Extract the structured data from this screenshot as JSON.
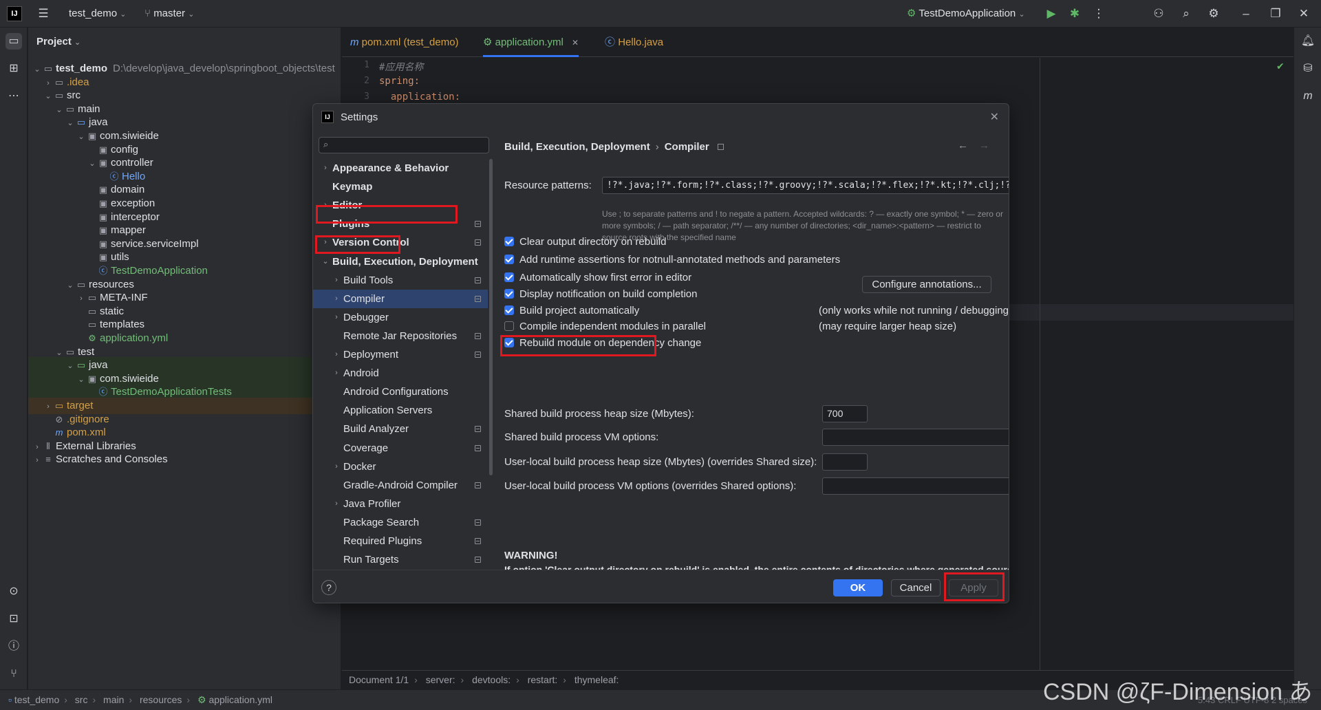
{
  "titlebar": {
    "project": "test_demo",
    "branch": "master",
    "run_config": "TestDemoApplication",
    "logo": "IJ"
  },
  "project_panel": {
    "header": "Project",
    "tree": [
      {
        "name": "test_demo",
        "extra": "D:\\develop\\java_develop\\springboot_objects\\test",
        "depth": 0,
        "arrow": "v",
        "icon": "folder",
        "style": "bold"
      },
      {
        "name": ".idea",
        "depth": 1,
        "arrow": ">",
        "icon": "folder",
        "style": "orange"
      },
      {
        "name": "src",
        "depth": 1,
        "arrow": "v",
        "icon": "folder"
      },
      {
        "name": "main",
        "depth": 2,
        "arrow": "v",
        "icon": "folder"
      },
      {
        "name": "java",
        "depth": 3,
        "arrow": "v",
        "icon": "folder-blue"
      },
      {
        "name": "com.siwieide",
        "depth": 4,
        "arrow": "v",
        "icon": "package"
      },
      {
        "name": "config",
        "depth": 5,
        "icon": "package"
      },
      {
        "name": "controller",
        "depth": 5,
        "arrow": "v",
        "icon": "package"
      },
      {
        "name": "Hello",
        "depth": 6,
        "icon": "class",
        "style": "blue"
      },
      {
        "name": "domain",
        "depth": 5,
        "icon": "package"
      },
      {
        "name": "exception",
        "depth": 5,
        "icon": "package"
      },
      {
        "name": "interceptor",
        "depth": 5,
        "icon": "package"
      },
      {
        "name": "mapper",
        "depth": 5,
        "icon": "package"
      },
      {
        "name": "service.serviceImpl",
        "depth": 5,
        "icon": "package"
      },
      {
        "name": "utils",
        "depth": 5,
        "icon": "package"
      },
      {
        "name": "TestDemoApplication",
        "depth": 5,
        "icon": "spring",
        "style": "green"
      },
      {
        "name": "resources",
        "depth": 3,
        "arrow": "v",
        "icon": "folder"
      },
      {
        "name": "META-INF",
        "depth": 4,
        "arrow": ">",
        "icon": "folder"
      },
      {
        "name": "static",
        "depth": 4,
        "icon": "folder"
      },
      {
        "name": "templates",
        "depth": 4,
        "icon": "folder"
      },
      {
        "name": "application.yml",
        "depth": 4,
        "icon": "yml",
        "style": "green"
      },
      {
        "name": "test",
        "depth": 2,
        "arrow": "v",
        "icon": "folder"
      },
      {
        "name": "java",
        "depth": 3,
        "arrow": "v",
        "icon": "folder-green",
        "bg": "test"
      },
      {
        "name": "com.siwieide",
        "depth": 4,
        "arrow": "v",
        "icon": "package",
        "bg": "test"
      },
      {
        "name": "TestDemoApplicationTests",
        "depth": 5,
        "icon": "spring",
        "style": "green",
        "bg": "test"
      },
      {
        "name": "target",
        "depth": 1,
        "arrow": ">",
        "icon": "folder-orange",
        "style": "orange",
        "bg": "target"
      },
      {
        "name": ".gitignore",
        "depth": 1,
        "icon": "ignore",
        "style": "orange"
      },
      {
        "name": "pom.xml",
        "depth": 1,
        "icon": "maven",
        "style": "orange"
      },
      {
        "name": "External Libraries",
        "depth": 0,
        "arrow": ">",
        "icon": "library"
      },
      {
        "name": "Scratches and Consoles",
        "depth": 0,
        "arrow": ">",
        "icon": "scratch"
      }
    ]
  },
  "editor": {
    "tabs": [
      {
        "label": "pom.xml (test_demo)",
        "icon": "m",
        "style": "orange"
      },
      {
        "label": "application.yml",
        "icon": "yml",
        "style": "green",
        "active": true
      },
      {
        "label": "Hello.java",
        "icon": "class",
        "style": "orange"
      }
    ],
    "lines": [
      {
        "num": "1",
        "text": "#应用名称",
        "kind": "comment"
      },
      {
        "num": "2",
        "text": "spring:",
        "kind": "key"
      },
      {
        "num": "3",
        "text": "  application:",
        "kind": "key"
      }
    ],
    "breadcrumbs": [
      "Document 1/1",
      "server:",
      "devtools:",
      "restart:",
      "thymeleaf:"
    ]
  },
  "statusbar": {
    "path": [
      "test_demo",
      "src",
      "main",
      "resources",
      "application.yml"
    ],
    "right": "5:43   CRLF   UTF-8   2 spaces",
    "watermark": "CSDN @ζF-Dimension あ"
  },
  "settings": {
    "title": "Settings",
    "search_placeholder": "",
    "nav": [
      {
        "label": "Appearance & Behavior",
        "arrow": ">",
        "level": 0,
        "bold": true
      },
      {
        "label": "Keymap",
        "level": 0,
        "bold": true
      },
      {
        "label": "Editor",
        "arrow": ">",
        "level": 0,
        "bold": true
      },
      {
        "label": "Plugins",
        "level": 0,
        "bold": true,
        "badge": true
      },
      {
        "label": "Version Control",
        "arrow": ">",
        "level": 0,
        "bold": true,
        "badge": true
      },
      {
        "label": "Build, Execution, Deployment",
        "arrow": "v",
        "level": 0,
        "bold": true
      },
      {
        "label": "Build Tools",
        "arrow": ">",
        "level": 1,
        "badge": true
      },
      {
        "label": "Compiler",
        "arrow": ">",
        "level": 1,
        "badge": true,
        "selected": true
      },
      {
        "label": "Debugger",
        "arrow": ">",
        "level": 1
      },
      {
        "label": "Remote Jar Repositories",
        "level": 1,
        "badge": true
      },
      {
        "label": "Deployment",
        "arrow": ">",
        "level": 1,
        "badge": true
      },
      {
        "label": "Android",
        "arrow": ">",
        "level": 1
      },
      {
        "label": "Android Configurations",
        "level": 1
      },
      {
        "label": "Application Servers",
        "level": 1
      },
      {
        "label": "Build Analyzer",
        "level": 1,
        "badge": true
      },
      {
        "label": "Coverage",
        "level": 1,
        "badge": true
      },
      {
        "label": "Docker",
        "arrow": ">",
        "level": 1
      },
      {
        "label": "Gradle-Android Compiler",
        "level": 1,
        "badge": true
      },
      {
        "label": "Java Profiler",
        "arrow": ">",
        "level": 1
      },
      {
        "label": "Package Search",
        "level": 1,
        "badge": true
      },
      {
        "label": "Required Plugins",
        "level": 1,
        "badge": true
      },
      {
        "label": "Run Targets",
        "level": 1,
        "badge": true
      }
    ],
    "crumb": {
      "parent": "Build, Execution, Deployment",
      "child": "Compiler"
    },
    "resource_patterns": {
      "label": "Resource patterns:",
      "value": "!?*.java;!?*.form;!?*.class;!?*.groovy;!?*.scala;!?*.flex;!?*.kt;!?*.clj;!?*.aj",
      "hint": "Use ; to separate patterns and ! to negate a pattern. Accepted wildcards: ? — exactly one symbol; * — zero or more symbols; / — path separator; /**/ — any number of directories; <dir_name>:<pattern> — restrict to source roots with the specified name"
    },
    "options": [
      {
        "label": "Clear output directory on rebuild",
        "checked": true
      },
      {
        "label": "Add runtime assertions for notnull-annotated methods and parameters",
        "checked": true
      },
      {
        "label": "Automatically show first error in editor",
        "checked": true
      },
      {
        "label": "Display notification on build completion",
        "checked": true
      },
      {
        "label": "Build project automatically",
        "checked": true,
        "note": "(only works while not running / debugging)"
      },
      {
        "label": "Compile independent modules in parallel",
        "checked": false,
        "note": "(may require larger heap size)"
      },
      {
        "label": "Rebuild module on dependency change",
        "checked": true
      }
    ],
    "configure_annotations": "Configure annotations...",
    "fields": [
      {
        "label": "Shared build process heap size (Mbytes):",
        "value": "700"
      },
      {
        "label": "Shared build process VM options:",
        "value": ""
      },
      {
        "label": "User-local build process heap size (Mbytes) (overrides Shared size):",
        "value": ""
      },
      {
        "label": "User-local build process VM options (overrides Shared options):",
        "value": ""
      }
    ],
    "warning_title": "WARNING!",
    "warning_text": "If option 'Clear output directory on rebuild' is enabled, the entire contents of directories where generated sources are stored WILL BE CLEARED on rebuild.",
    "buttons": {
      "ok": "OK",
      "cancel": "Cancel",
      "apply": "Apply"
    },
    "help": "?"
  },
  "colors": {
    "accent": "#3574f0",
    "highlight": "#e0181f",
    "selected": "#2e436e"
  }
}
